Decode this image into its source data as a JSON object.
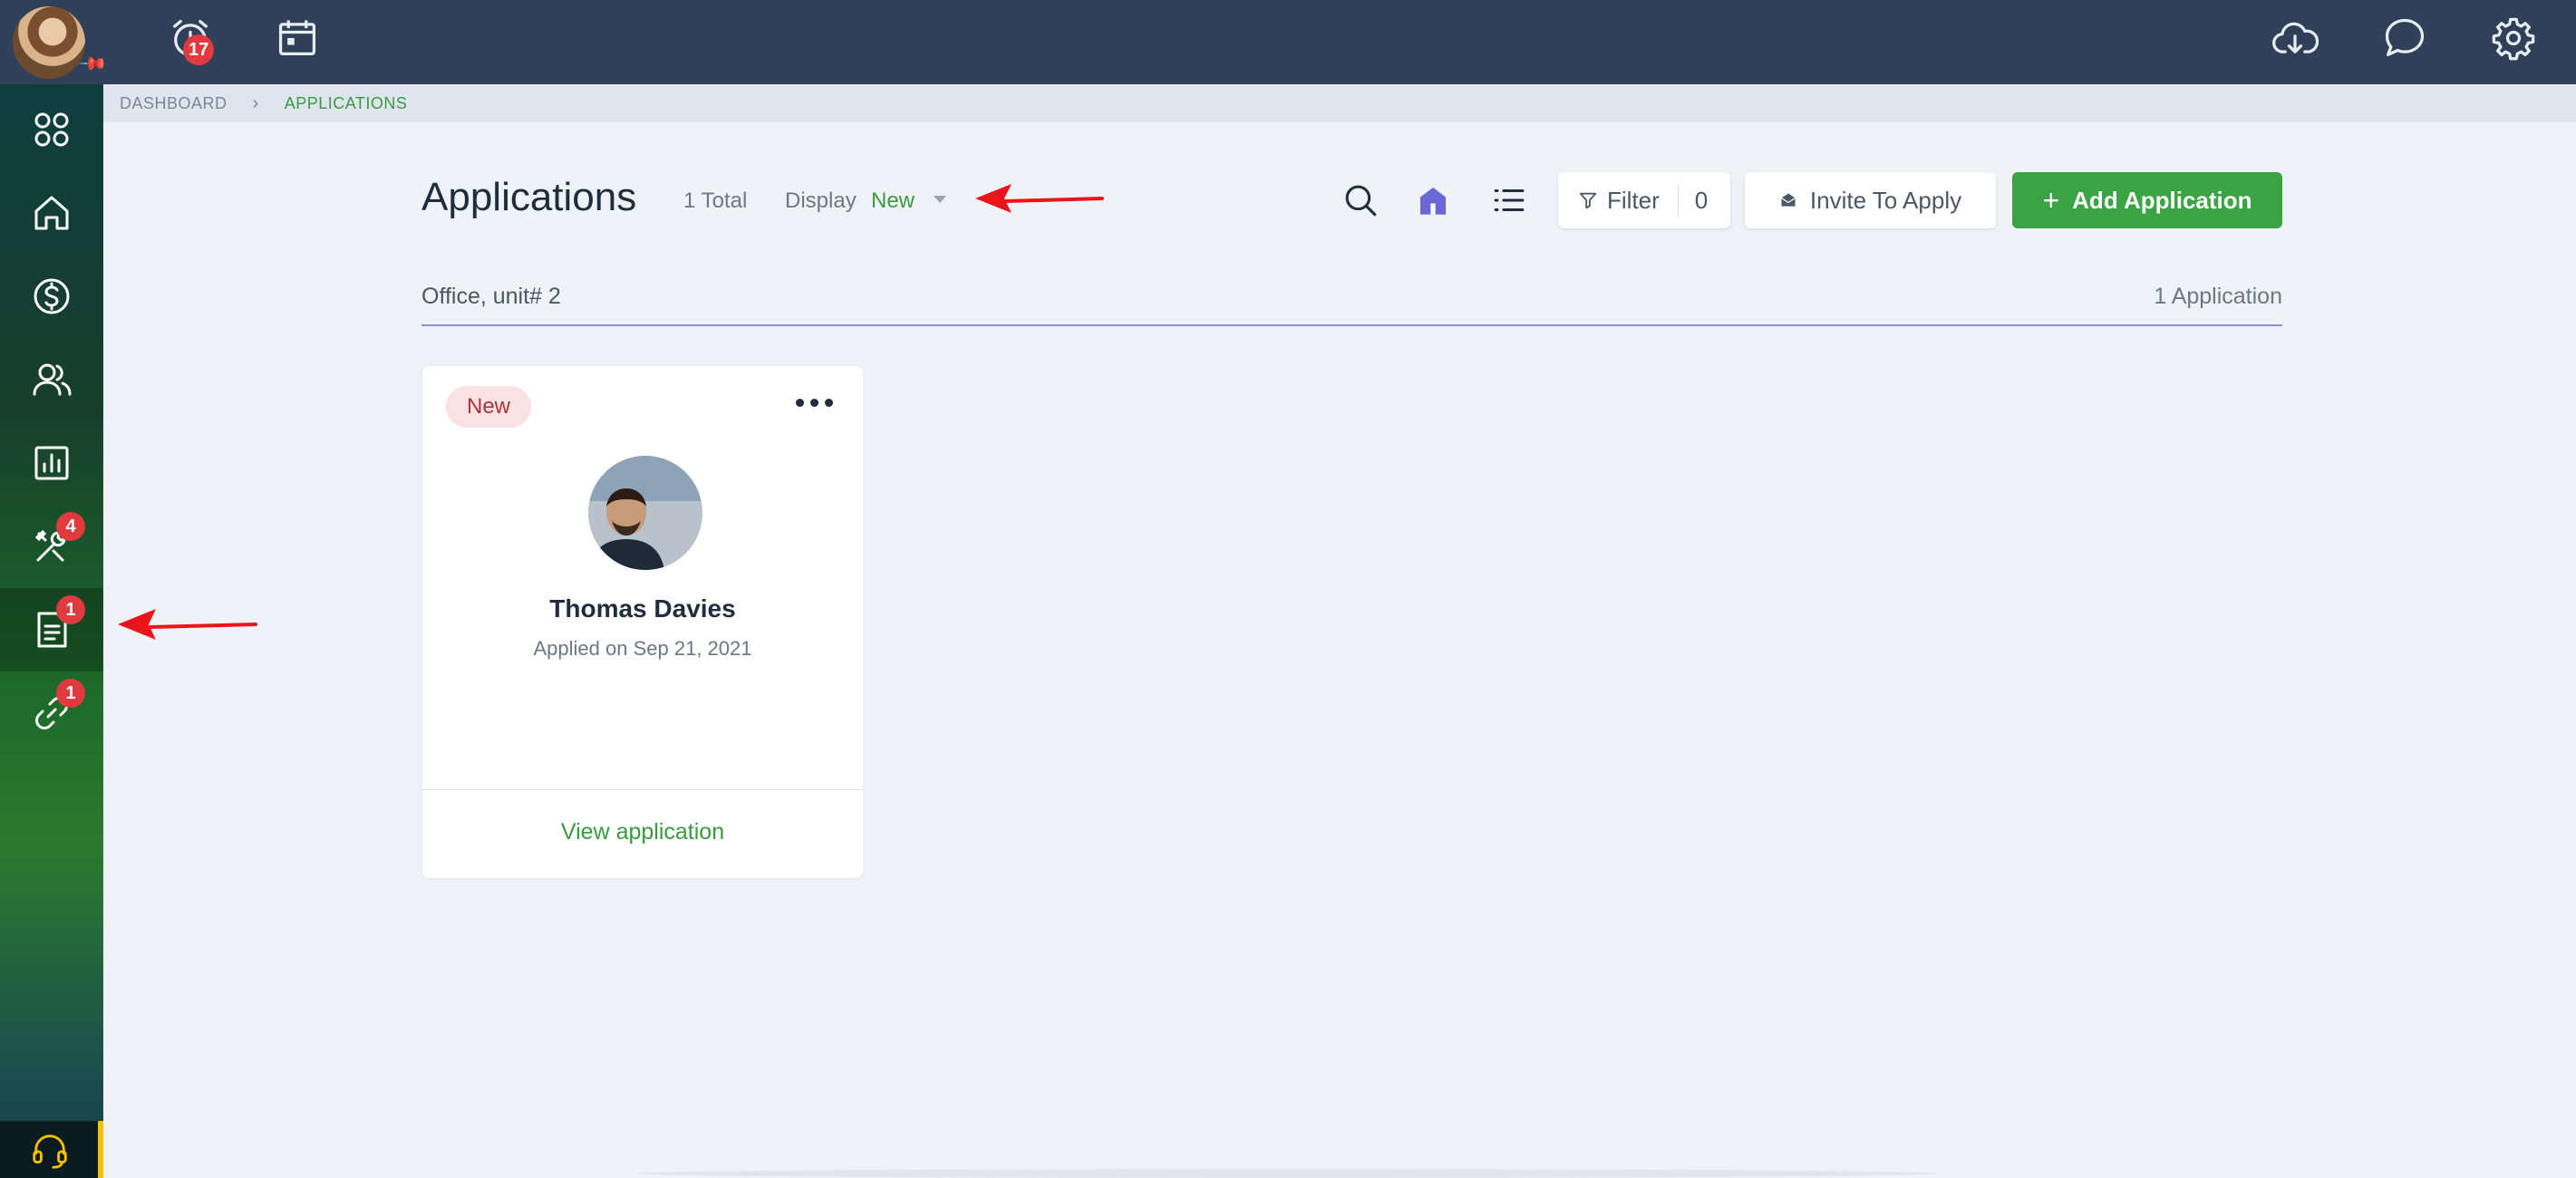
{
  "topbar": {
    "notifications_badge": "17"
  },
  "sidebar": {
    "items": [
      {
        "name": "apps",
        "icon": "apps-grid-icon"
      },
      {
        "name": "home",
        "icon": "home-icon"
      },
      {
        "name": "accounting",
        "icon": "dollar-icon"
      },
      {
        "name": "people",
        "icon": "users-icon"
      },
      {
        "name": "reports",
        "icon": "chart-icon"
      },
      {
        "name": "maintenance",
        "icon": "tools-icon",
        "badge": "4"
      },
      {
        "name": "applications",
        "icon": "document-icon",
        "badge": "1",
        "active": true
      },
      {
        "name": "links",
        "icon": "link-icon",
        "badge": "1"
      }
    ]
  },
  "breadcrumb": {
    "dashboard": "DASHBOARD",
    "current": "APPLICATIONS"
  },
  "header": {
    "title": "Applications",
    "total": "1 Total",
    "display_label": "Display",
    "display_value": "New"
  },
  "toolbar": {
    "filter_label": "Filter",
    "filter_count": "0",
    "invite_label": "Invite To Apply",
    "add_plus": "+",
    "add_label": "Add Application"
  },
  "group": {
    "name": "Office, unit# 2",
    "count": "1 Application"
  },
  "card": {
    "status": "New",
    "applicant_name": "Thomas Davies",
    "applied_on": "Applied on Sep 21, 2021",
    "view_link": "View application"
  },
  "colors": {
    "accent_green": "#3aa343",
    "topbar": "#2f4058",
    "badge_red": "#e0393e",
    "group_line": "#8f8fd8",
    "annotation_arrow": "#e8151b"
  }
}
